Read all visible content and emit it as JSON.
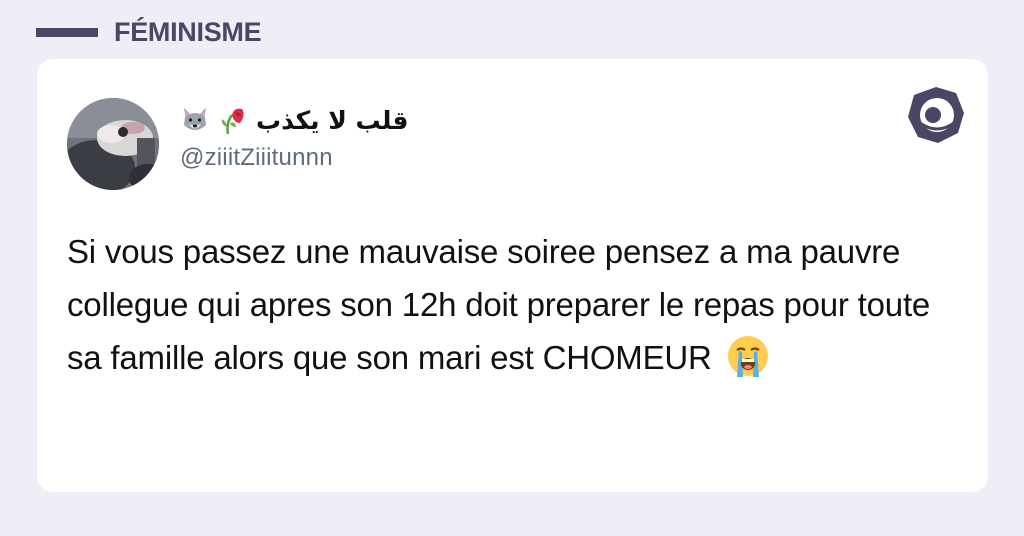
{
  "category": {
    "label": "FÉMINISME",
    "accent_color": "#4d4566"
  },
  "tweet": {
    "author": {
      "display_name": "قلب لا يكذب",
      "name_emojis": [
        "wolf-face-emoji",
        "wilted-rose-emoji"
      ],
      "handle": "@ziiitZiiitunnn",
      "avatar": "avatar-photo"
    },
    "text": "Si vous passez une mauvaise soiree pensez a ma pauvre collegue qui apres son 12h doit preparer le repas pour toute sa famille alors que son mari est CHOMEUR",
    "trailing_emoji": "loudly-crying-face-emoji"
  },
  "brand": {
    "icon": "brand-logo-icon",
    "color": "#4d4566"
  },
  "colors": {
    "background": "#efedf6",
    "card": "#ffffff",
    "handle": "#5e6b78"
  }
}
